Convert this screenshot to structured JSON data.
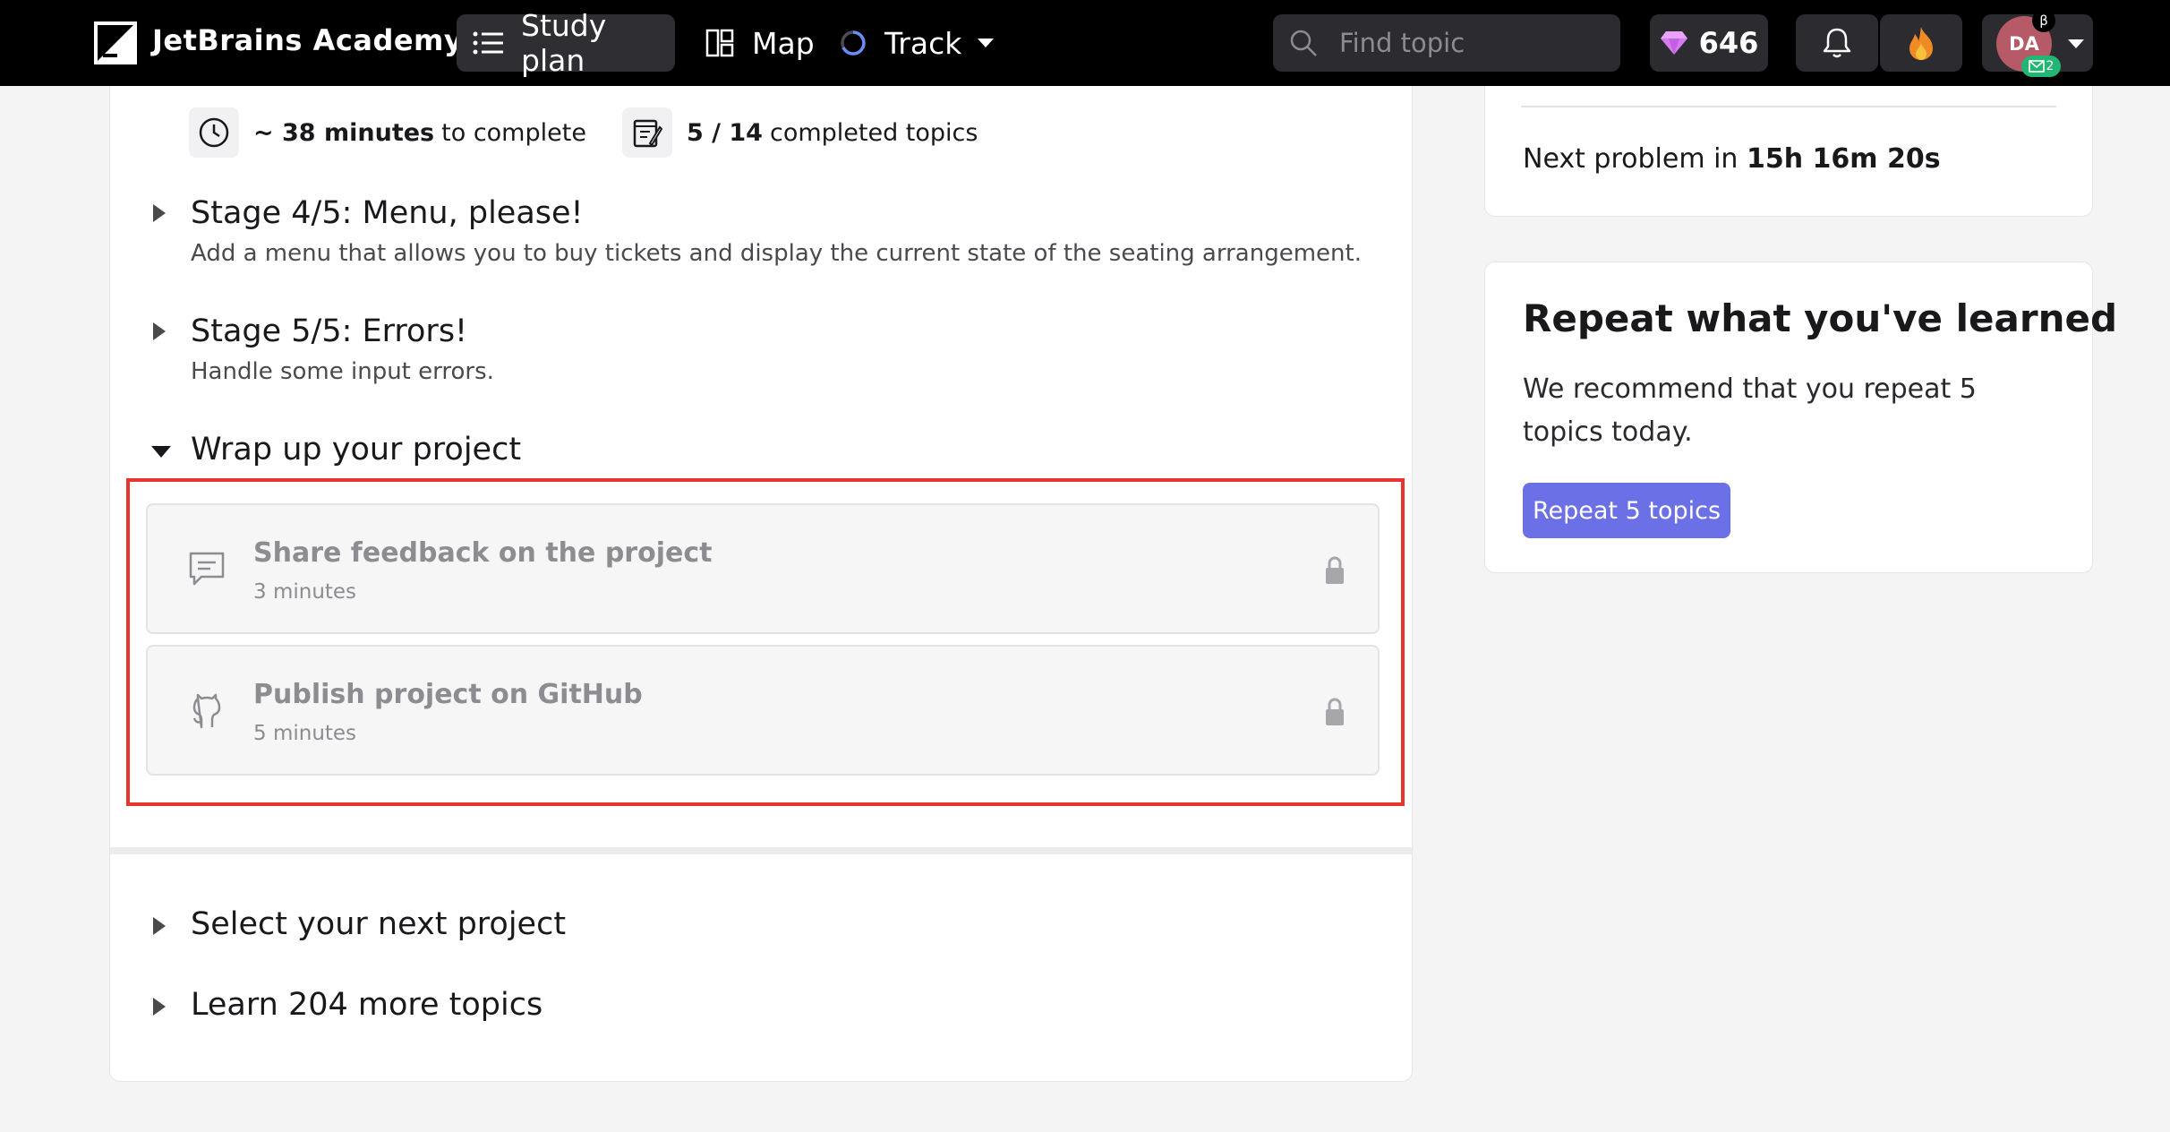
{
  "header": {
    "brand": "JetBrains Academy",
    "nav": {
      "study_plan": "Study plan",
      "map": "Map",
      "track": "Track"
    },
    "search": {
      "placeholder": "Find topic"
    },
    "gems": "646",
    "profile": {
      "initials": "DA",
      "beta": "β",
      "badge_count": "2"
    }
  },
  "project": {
    "time_value": "~ 38 minutes",
    "time_suffix": "to complete",
    "topics_value": "5 / 14",
    "topics_suffix": "completed topics",
    "stages": [
      {
        "title": "Stage 4/5: Menu, please!",
        "description": "Add a menu that allows you to buy tickets and display the current state of the seating arrangement."
      },
      {
        "title": "Stage 5/5: Errors!",
        "description": "Handle some input errors."
      }
    ],
    "wrap_up": {
      "title": "Wrap up your project",
      "tasks": [
        {
          "title": "Share feedback on the project",
          "duration": "3 minutes",
          "icon": "feedback-icon",
          "locked": true
        },
        {
          "title": "Publish project on GitHub",
          "duration": "5 minutes",
          "icon": "github-icon",
          "locked": true
        }
      ]
    },
    "next_project": "Select your next project",
    "more_topics": "Learn 204 more topics"
  },
  "sidebar": {
    "next_problem_prefix": "Next problem in",
    "next_problem_time": "15h 16m 20s",
    "repeat": {
      "title": "Repeat what you've learned",
      "description": "We recommend that you repeat 5 topics today.",
      "button": "Repeat 5 topics"
    }
  },
  "colors": {
    "accent_button": "#6b70e6",
    "highlight_border": "#e8352f",
    "header_bg": "#000000",
    "gem": "#d57bf0"
  }
}
